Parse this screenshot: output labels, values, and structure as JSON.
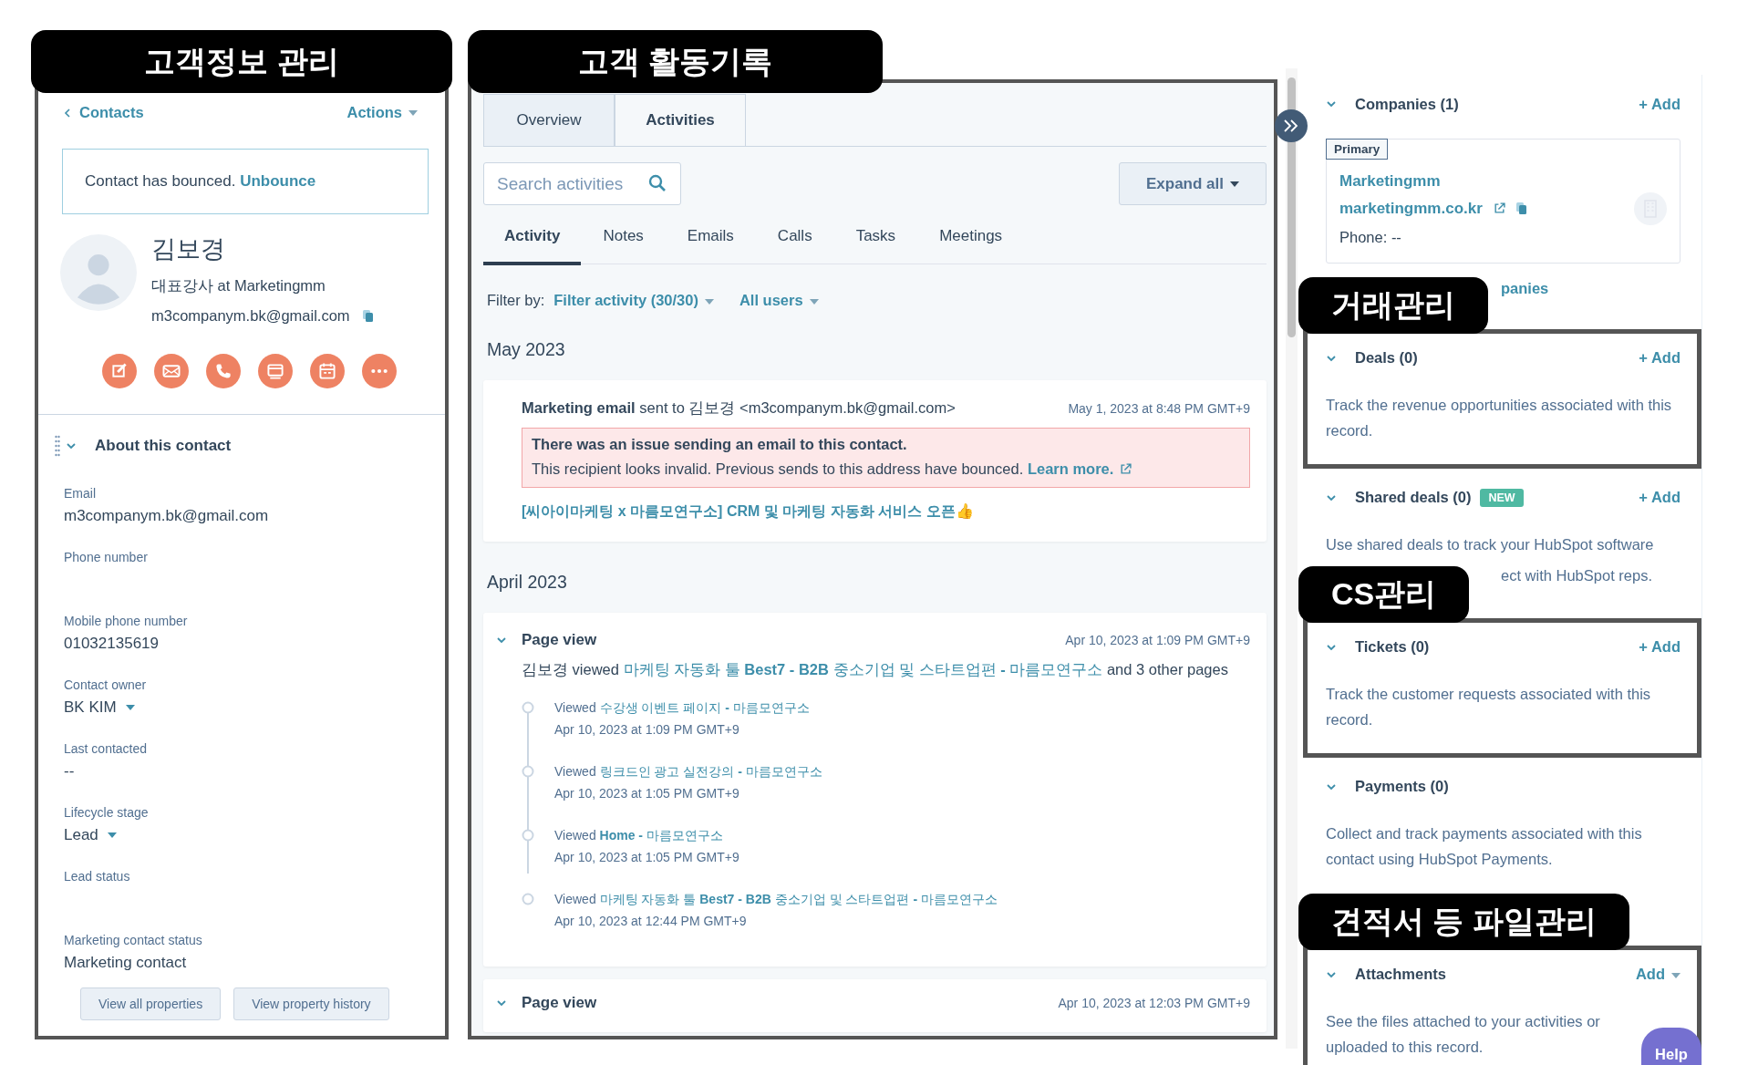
{
  "contact_panel": {
    "annotation": "고객정보 관리",
    "back_link": "Contacts",
    "actions": "Actions",
    "alert": {
      "text": "Contact has bounced.",
      "link": "Unbounce"
    },
    "name": "김보경",
    "job": "대표강사 at Marketingmm",
    "email": "m3companym.bk@gmail.com",
    "section_title": "About this contact",
    "properties": [
      {
        "label": "Email",
        "value": "m3companym.bk@gmail.com"
      },
      {
        "label": "Phone number"
      },
      {
        "label": "Mobile phone number",
        "value": "01032135619"
      },
      {
        "label": "Contact owner",
        "value": "BK KIM",
        "dropdown": true
      },
      {
        "label": "Last contacted",
        "value": "--"
      },
      {
        "label": "Lifecycle stage",
        "value": "Lead",
        "dropdown": true
      },
      {
        "label": "Lead status"
      },
      {
        "label": "Marketing contact status",
        "value": "Marketing contact"
      }
    ],
    "buttons": [
      "View all properties",
      "View property history"
    ]
  },
  "activity_panel": {
    "annotation": "고객 활동기록",
    "tabs": [
      {
        "label": "Overview",
        "selected": false
      },
      {
        "label": "Activities",
        "selected": true
      }
    ],
    "search": {
      "placeholder": "Search activities"
    },
    "expand_button": "Expand all",
    "subtabs": [
      {
        "label": "Activity",
        "selected": true
      },
      {
        "label": "Notes",
        "selected": false
      },
      {
        "label": "Emails",
        "selected": false
      },
      {
        "label": "Calls",
        "selected": false
      },
      {
        "label": "Tasks",
        "selected": false
      },
      {
        "label": "Meetings",
        "selected": false
      }
    ],
    "filter_label": "Filter by:",
    "filters": [
      "Filter activity (30/30)",
      "All users"
    ],
    "groups": [
      {
        "month": "May 2023",
        "items": [
          {
            "kind": "email",
            "title": "**Marketing email** sent to 김보경 <m3companym.bk@gmail.com>",
            "time": "May 1, 2023 at 8:48 PM GMT+9",
            "error_title": "There was an issue sending an email to this contact.",
            "error_text": "This recipient looks invalid. Previous sends to this address have bounced.",
            "error_link": "Learn more.",
            "subject": "[씨아이마케팅 x 마름모연구소] CRM 및 마케팅 자동화 서비스 오픈👍"
          }
        ]
      },
      {
        "month": "April 2023",
        "items": [
          {
            "kind": "page_view",
            "title": "Page view",
            "time": "Apr 10, 2023 at 1:09 PM GMT+9",
            "summary_before": "김보경 viewed",
            "summary_link": "마케팅 자동화 툴 **Best7 - B2B** 중소기업 및 스타트업편 **-** 마름모연구소",
            "summary_after": "and 3 other pages",
            "views": [
              {
                "prefix": "Viewed",
                "page": "수강생 이벤트 페이지 **-** 마름모연구소",
                "time": "Apr 10, 2023 at 1:09 PM GMT+9"
              },
              {
                "prefix": "Viewed",
                "page": "링크드인 광고 실전강의 **-** 마름모연구소",
                "time": "Apr 10, 2023 at 1:05 PM GMT+9"
              },
              {
                "prefix": "Viewed",
                "page": "**Home -** 마름모연구소",
                "time": "Apr 10, 2023 at 1:05 PM GMT+9"
              },
              {
                "prefix": "Viewed",
                "page": "마케팅 자동화 툴 **Best7 - B2B** 중소기업 및 스타트업편 **-** 마름모연구소",
                "time": "Apr 10, 2023 at 12:44 PM GMT+9"
              }
            ]
          },
          {
            "kind": "page_view",
            "title": "Page view",
            "time": "Apr 10, 2023 at 12:03 PM GMT+9"
          }
        ]
      }
    ]
  },
  "sidebar": {
    "sections": [
      {
        "kind": "companies",
        "title": "Companies (1)",
        "add": "+ Add",
        "company": {
          "tag": "Primary",
          "name": "Marketingmm",
          "domain": "marketingmm.co.kr",
          "phone": "Phone: --"
        },
        "footer_link": "panies"
      },
      {
        "kind": "plain",
        "title": "Deals (0)",
        "add": "+ Add",
        "description": "Track the revenue opportunities associated with this record.",
        "annotation": "거래관리"
      },
      {
        "kind": "plain",
        "title": "Shared deals (0)",
        "badge": "NEW",
        "add": "+ Add",
        "description": "Use shared deals to track your HubSpot software",
        "description_tail": "ect with HubSpot reps."
      },
      {
        "kind": "plain",
        "title": "Tickets (0)",
        "add": "+ Add",
        "description": "Track the customer requests associated with this record.",
        "annotation": "CS관리"
      },
      {
        "kind": "plain",
        "title": "Payments (0)",
        "description": "Collect and track payments associated with this contact using HubSpot Payments."
      },
      {
        "kind": "plain",
        "title": "Attachments",
        "add": "Add",
        "add_dropdown": true,
        "description": "See the files attached to your activities or uploaded to this record.",
        "annotation": "견적서 등 파일관리",
        "help": "Help"
      }
    ]
  }
}
